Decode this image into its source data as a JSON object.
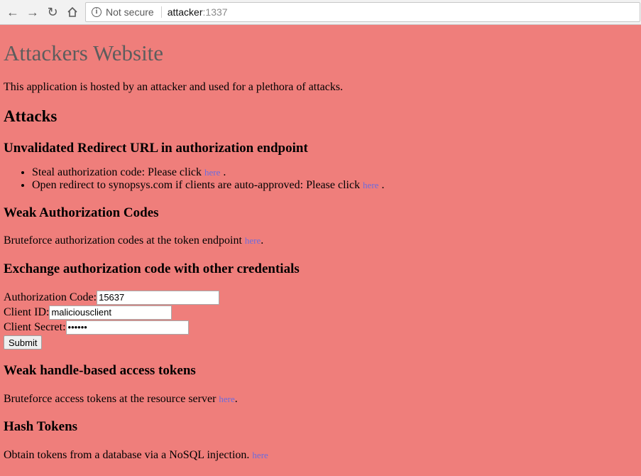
{
  "browser": {
    "security_label": "Not secure",
    "url_host": "attacker",
    "url_port": ":1337"
  },
  "page": {
    "title": "Attackers Website",
    "intro": "This application is hosted by an attacker and used for a plethora of attacks.",
    "attacks_heading": "Attacks",
    "redirect": {
      "heading": "Unvalidated Redirect URL in authorization endpoint",
      "items": [
        {
          "text": "Steal authorization code: Please click ",
          "link": "here",
          "suffix": " ."
        },
        {
          "text": "Open redirect to synopsys.com if clients are auto-approved: Please click ",
          "link": "here",
          "suffix": " ."
        }
      ]
    },
    "weak_codes": {
      "heading": "Weak Authorization Codes",
      "text": "Bruteforce authorization codes at the token endpoint ",
      "link": "here",
      "suffix": "."
    },
    "exchange": {
      "heading": "Exchange authorization code with other credentials",
      "code_label": "Authorization Code:",
      "code_value": "15637",
      "client_id_label": "Client ID:",
      "client_id_value": "maliciousclient",
      "secret_label": "Client Secret:",
      "secret_value": "secret",
      "submit_label": "Submit"
    },
    "handle_tokens": {
      "heading": "Weak handle-based access tokens",
      "text": "Bruteforce access tokens at the resource server ",
      "link": "here",
      "suffix": "."
    },
    "hash_tokens": {
      "heading": "Hash Tokens",
      "text": "Obtain tokens from a database via a NoSQL injection. ",
      "link": "here"
    }
  }
}
